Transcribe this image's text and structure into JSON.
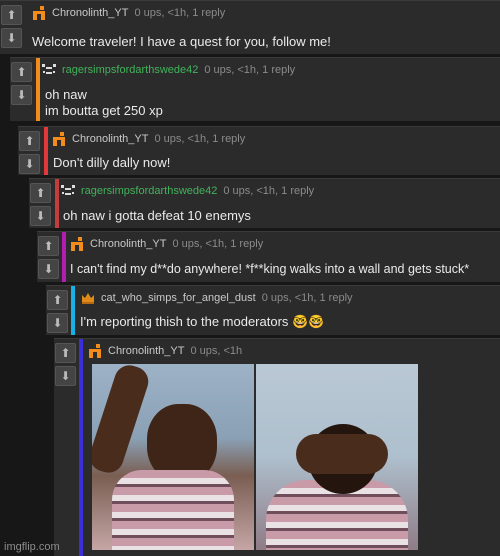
{
  "comments": [
    {
      "user": "Chronolinth_YT",
      "meta": "0 ups, <1h, 1 reply",
      "text": "Welcome traveler! I have a quest for you, follow me!",
      "bar_color": "",
      "avatar": "orange-r-logo-icon"
    },
    {
      "user": "ragersimpsfordarthswede42",
      "meta": "0 ups, <1h, 1 reply",
      "text": "oh naw\nim boutta get 250 xp",
      "bar_color": "#f28c1c",
      "avatar": "pixel-face-icon"
    },
    {
      "user": "Chronolinth_YT",
      "meta": "0 ups, <1h, 1 reply",
      "text": "Don't dilly dally now!",
      "bar_color": "#e0383b",
      "avatar": "orange-r-logo-icon"
    },
    {
      "user": "ragersimpsfordarthswede42",
      "meta": "0 ups, <1h, 1 reply",
      "text": "oh naw i gotta defeat 10 enemys",
      "bar_color": "#c23d3d",
      "avatar": "pixel-face-icon"
    },
    {
      "user": "Chronolinth_YT",
      "meta": "0 ups, <1h, 1 reply",
      "text": "I can't find my d**do anywhere! *f**king walks into a wall and gets stuck*",
      "bar_color": "#b41cb4",
      "avatar": "orange-r-logo-icon"
    },
    {
      "user": "cat_who_simps_for_angel_dust",
      "meta": "0 ups, <1h, 1 reply",
      "text": "I'm reporting thish to the moderators 🤓🤓",
      "bar_color": "#16b2e6",
      "avatar": "crown-icon"
    },
    {
      "user": "Chronolinth_YT",
      "meta": "0 ups, <1h",
      "text": "",
      "bar_color": "#3a2fd8",
      "avatar": "orange-r-logo-icon"
    }
  ],
  "watermark": "imgflip.com",
  "vote_up": "⬆",
  "vote_down": "⬇"
}
